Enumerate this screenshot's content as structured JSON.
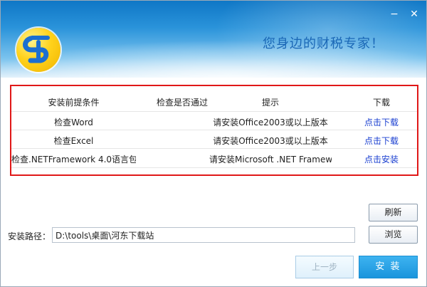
{
  "header": {
    "slogan": "您身边的财税专家！",
    "minimize_glyph": "−",
    "close_glyph": "✕"
  },
  "requirements": {
    "columns": [
      "安装前提条件",
      "检查是否通过",
      "提示",
      "下载"
    ],
    "rows": [
      {
        "condition": "检查Word",
        "passed": "",
        "tip": "请安装Office2003或以上版本",
        "action": "点击下载"
      },
      {
        "condition": "检查Excel",
        "passed": "",
        "tip": "请安装Office2003或以上版本",
        "action": "点击下载"
      },
      {
        "condition": "检查.NETFramework 4.0语言包",
        "passed": "",
        "tip": "请安装Microsoft .NET Framewo",
        "action": "点击安装"
      }
    ]
  },
  "install_path": {
    "label": "安装路径：",
    "value": "D:\\tools\\桌面\\河东下载站"
  },
  "buttons": {
    "refresh": "刷新",
    "browse": "浏览",
    "prev": "上一步",
    "install": "安 装"
  },
  "colors": {
    "accent": "#1a95dc",
    "highlight_border": "#e01818",
    "link": "#1a3fd0"
  },
  "icons": {
    "logo": "company-logo-icon"
  }
}
